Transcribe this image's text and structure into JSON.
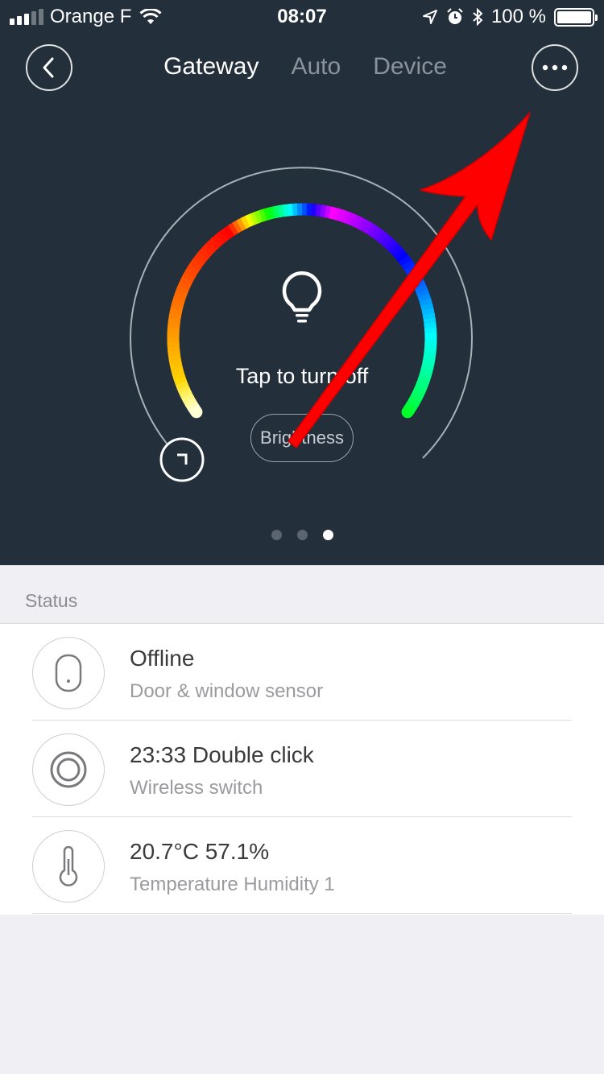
{
  "status_bar": {
    "carrier": "Orange F",
    "time": "08:07",
    "battery": "100 %"
  },
  "nav": {
    "tabs": [
      "Gateway",
      "Auto",
      "Device"
    ],
    "active_tab": "Gateway"
  },
  "gateway_light": {
    "center_text": "Tap to turn off",
    "brightness_label": "Brightness",
    "page_count": 3,
    "active_page": 3
  },
  "status": {
    "section_title": "Status",
    "items": [
      {
        "title": "Offline",
        "subtitle": "Door & window sensor",
        "icon": "door-sensor-icon"
      },
      {
        "title": "23:33 Double click",
        "subtitle": "Wireless switch",
        "icon": "wireless-switch-icon"
      },
      {
        "title": "20.7°C 57.1%",
        "subtitle": "Temperature Humidity 1",
        "icon": "thermometer-icon"
      }
    ]
  },
  "colors": {
    "header_bg": "#232f3b",
    "page_bg": "#efeff4",
    "annotation_arrow": "#ff0000"
  }
}
